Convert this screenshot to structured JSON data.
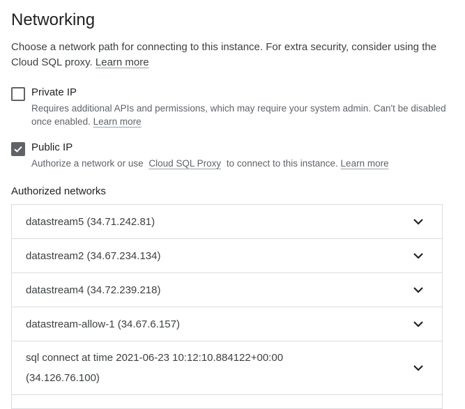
{
  "title": "Networking",
  "description": "Choose a network path for connecting to this instance. For extra security, consider using the Cloud SQL proxy.",
  "description_link": "Learn more",
  "private_ip": {
    "label": "Private IP",
    "checked": false,
    "help": "Requires additional APIs and permissions, which may require your system admin. Can't be disabled once enabled.",
    "help_link": "Learn more"
  },
  "public_ip": {
    "label": "Public IP",
    "checked": true,
    "help_prefix": "Authorize a network or use",
    "help_proxy_link": "Cloud SQL Proxy",
    "help_suffix": "to connect to this instance.",
    "help_link": "Learn more"
  },
  "authorized_networks": {
    "heading": "Authorized networks",
    "items": [
      {
        "name": "datastream5 (34.71.242.81)"
      },
      {
        "name": "datastream2 (34.67.234.134)"
      },
      {
        "name": "datastream4 (34.72.239.218)"
      },
      {
        "name": "datastream-allow-1 (34.67.6.157)"
      },
      {
        "name": "sql connect at time 2021-06-23 10:12:10.884122+00:00 (34.126.76.100)"
      }
    ]
  }
}
